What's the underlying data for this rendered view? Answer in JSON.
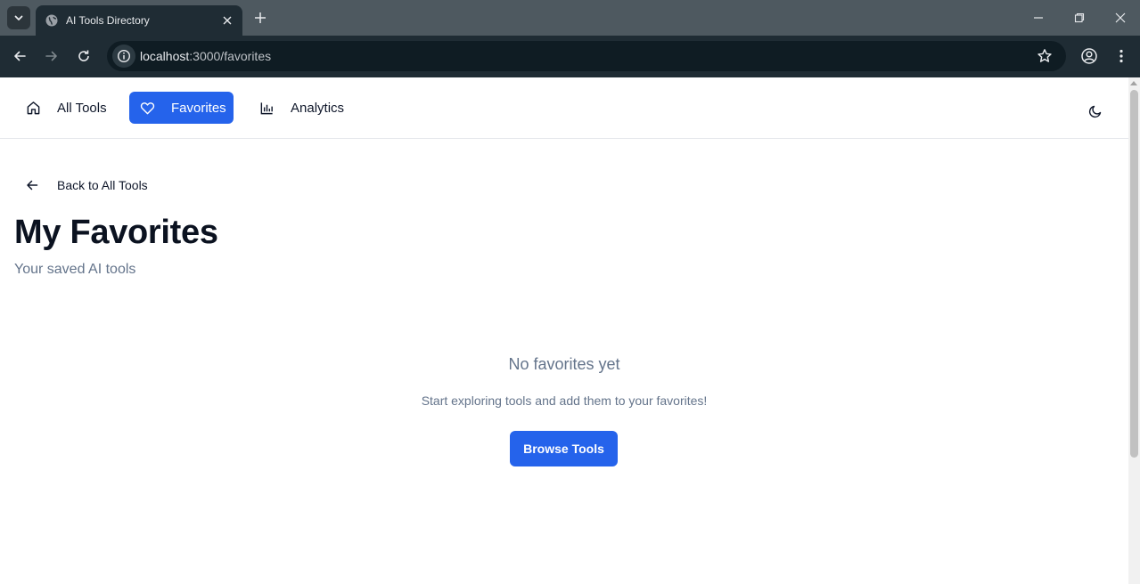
{
  "browser": {
    "tab_title": "AI Tools Directory",
    "url_host": "localhost",
    "url_path": ":3000/favorites",
    "icons": [
      "chevron-down-icon",
      "globe-icon",
      "close-icon",
      "plus-icon",
      "minimize-icon",
      "restore-icon",
      "close-window-icon",
      "back-arrow-icon",
      "forward-arrow-icon",
      "reload-icon",
      "info-icon",
      "star-icon",
      "profile-icon",
      "more-vert-icon"
    ]
  },
  "nav": {
    "items": [
      {
        "label": "All Tools",
        "icon": "home-icon"
      },
      {
        "label": "Favorites",
        "icon": "heart-icon"
      },
      {
        "label": "Analytics",
        "icon": "bar-chart-icon"
      }
    ],
    "theme_toggle_icon": "moon-icon"
  },
  "page": {
    "back_label": "Back to All Tools",
    "title": "My Favorites",
    "subtitle": "Your saved AI tools",
    "empty_title": "No favorites yet",
    "empty_desc": "Start exploring tools and add them to your favorites!",
    "browse_label": "Browse Tools"
  },
  "colors": {
    "primary": "#2563eb",
    "muted_text": "#64748b",
    "heading": "#0b1220"
  }
}
